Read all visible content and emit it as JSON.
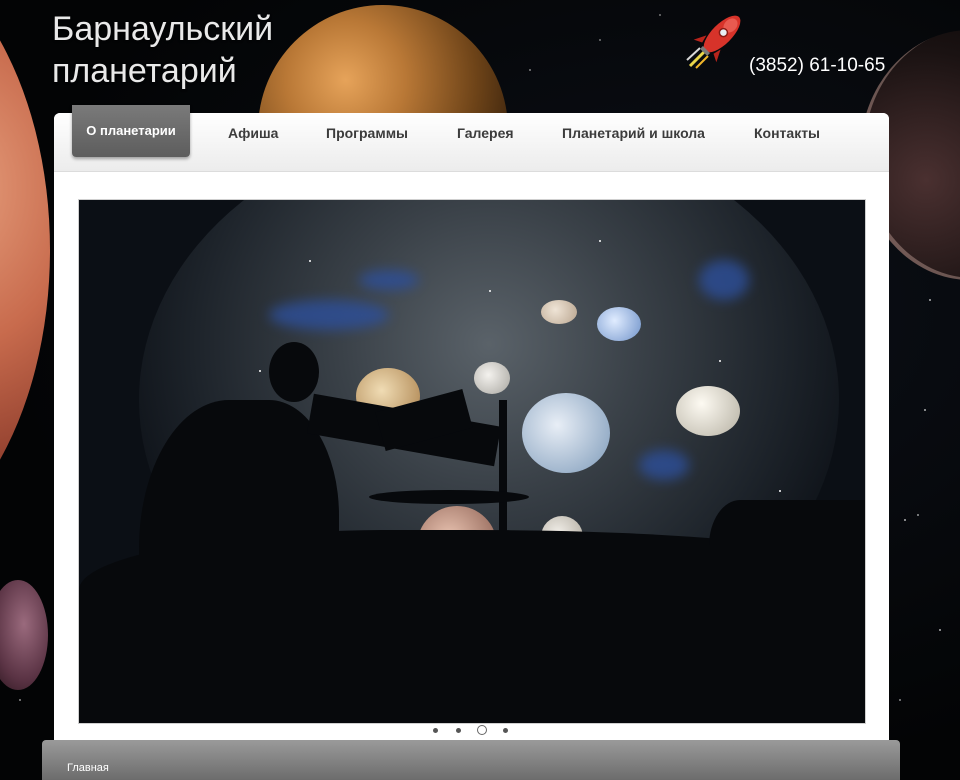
{
  "site": {
    "title_line1": "Барнаульский",
    "title_line2": "планетарий",
    "phone": "(3852) 61-10-65"
  },
  "nav": {
    "items": [
      {
        "label": "О планетарии",
        "active": true
      },
      {
        "label": "Афиша"
      },
      {
        "label": "Программы"
      },
      {
        "label": "Галерея"
      },
      {
        "label": "Планетарий и школа"
      },
      {
        "label": "Контакты"
      }
    ]
  },
  "slider": {
    "image": "planetarium-dome-telescope-photo",
    "total_slides": 4,
    "active_slide": 3
  },
  "footer": {
    "breadcrumb": "Главная"
  },
  "colors": {
    "nav_active_bg": "#6a6a6a",
    "nav_text": "#3c3c3c",
    "panel_bg": "#ffffff",
    "page_bg": "#050608"
  },
  "icons": [
    "rocket-icon"
  ]
}
